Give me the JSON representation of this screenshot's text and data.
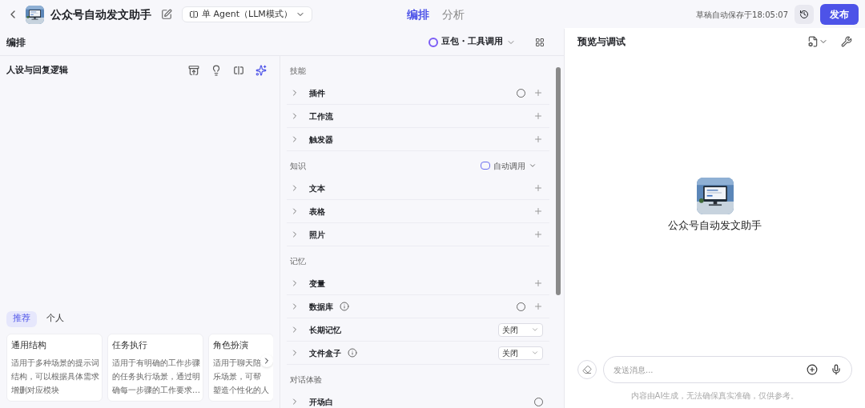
{
  "header": {
    "title": "公众号自动发文助手",
    "mode": "单 Agent（LLM模式）",
    "tabs": [
      {
        "label": "编排",
        "selected": true
      },
      {
        "label": "分析",
        "selected": false
      }
    ],
    "save_status": "草稿自动保存于18:05:07",
    "publish": "发布"
  },
  "arrange": {
    "title": "编排",
    "model": "豆包・工具调用"
  },
  "persona": {
    "title": "人设与回复逻辑",
    "template_tabs": [
      {
        "label": "推荐",
        "selected": true
      },
      {
        "label": "个人",
        "selected": false
      }
    ],
    "cards": [
      {
        "title": "通用结构",
        "lines": [
          "适用于多种场景的提示词",
          "结构，可以根据具体需求",
          "增删对应模块"
        ]
      },
      {
        "title": "任务执行",
        "lines": [
          "适用于有明确的工作步骤",
          "的任务执行场景，通过明",
          "确每一步骤的工作要求…"
        ]
      },
      {
        "title": "角色扮演",
        "lines": [
          "适用于聊天陪",
          "乐场景，可帮",
          "塑造个性化的人"
        ]
      }
    ]
  },
  "groups": [
    {
      "title": "技能",
      "items": [
        {
          "name": "插件",
          "info": false,
          "auto": true,
          "add": true
        },
        {
          "name": "工作流",
          "info": false,
          "auto": false,
          "add": true
        },
        {
          "name": "触发器",
          "info": false,
          "auto": false,
          "add": true
        }
      ]
    },
    {
      "title": "知识",
      "action": "自动调用",
      "items": [
        {
          "name": "文本",
          "info": false,
          "auto": false,
          "add": true
        },
        {
          "name": "表格",
          "info": false,
          "auto": false,
          "add": true
        },
        {
          "name": "照片",
          "info": false,
          "auto": false,
          "add": true
        }
      ]
    },
    {
      "title": "记忆",
      "items": [
        {
          "name": "变量",
          "info": false,
          "auto": false,
          "add": true
        },
        {
          "name": "数据库",
          "info": true,
          "auto": true,
          "add": true
        },
        {
          "name": "长期记忆",
          "info": false,
          "auto": false,
          "add": false,
          "select": "关闭"
        },
        {
          "name": "文件盒子",
          "info": true,
          "auto": false,
          "add": false,
          "select": "关闭"
        }
      ]
    },
    {
      "title": "对话体验",
      "items": [
        {
          "name": "开场白",
          "info": false,
          "auto": true,
          "add": false
        }
      ]
    }
  ],
  "preview": {
    "title": "预览与调试",
    "bot_name": "公众号自动发文助手",
    "placeholder": "发送消息...",
    "disclaimer": "内容由AI生成，无法确保真实准确，仅供参考。"
  }
}
